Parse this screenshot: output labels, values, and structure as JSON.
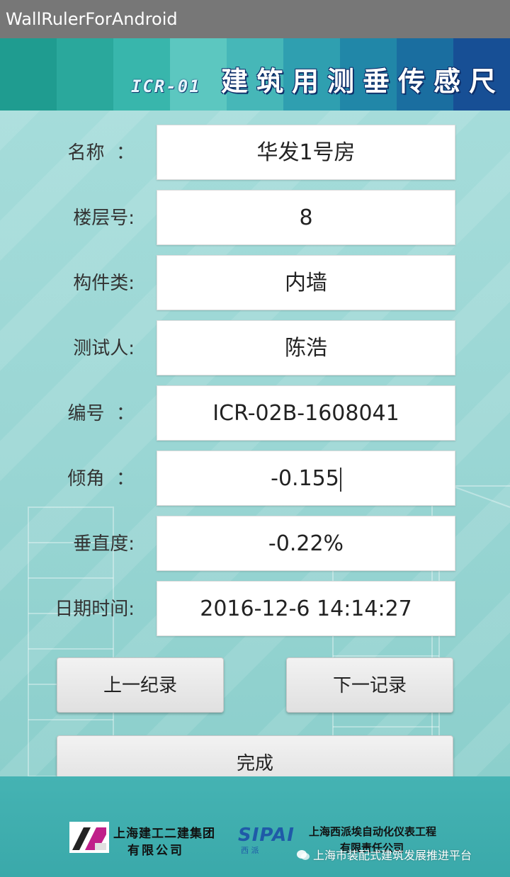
{
  "window": {
    "title": "WallRulerForAndroid"
  },
  "banner": {
    "code": "ICR-01",
    "title": "建筑用测垂传感尺"
  },
  "form": {
    "rows": [
      {
        "label": "名称  ：",
        "value": "华发1号房"
      },
      {
        "label": "楼层号:",
        "value": "8"
      },
      {
        "label": "构件类:",
        "value": "内墙"
      },
      {
        "label": "测试人:",
        "value": "陈浩"
      },
      {
        "label": "编号  ：",
        "value": "ICR-02B-1608041"
      },
      {
        "label": "倾角  ：",
        "value": "-0.155"
      },
      {
        "label": "垂直度:",
        "value": "-0.22%"
      },
      {
        "label": "日期时间:",
        "value": "2016-12-6 14:14:27"
      }
    ]
  },
  "buttons": {
    "prev_label": "上一纪录",
    "next_label": "下一记录",
    "done_label": "完成"
  },
  "footer": {
    "company1_line1": "上海建工二建集团",
    "company1_line2": "有限公司",
    "company2_logo": "SIPAI",
    "company2_sub": "西  派",
    "company2_line1": "上海西派埃自动化仪表工程",
    "company2_line2": "有限责任公司",
    "watermark": "上海市装配式建筑发展推进平台"
  },
  "colors": {
    "titlebar": "#777777",
    "background": "#9ad6d4",
    "footer": "#3aa9aa",
    "banner_dark": "#174f95"
  }
}
